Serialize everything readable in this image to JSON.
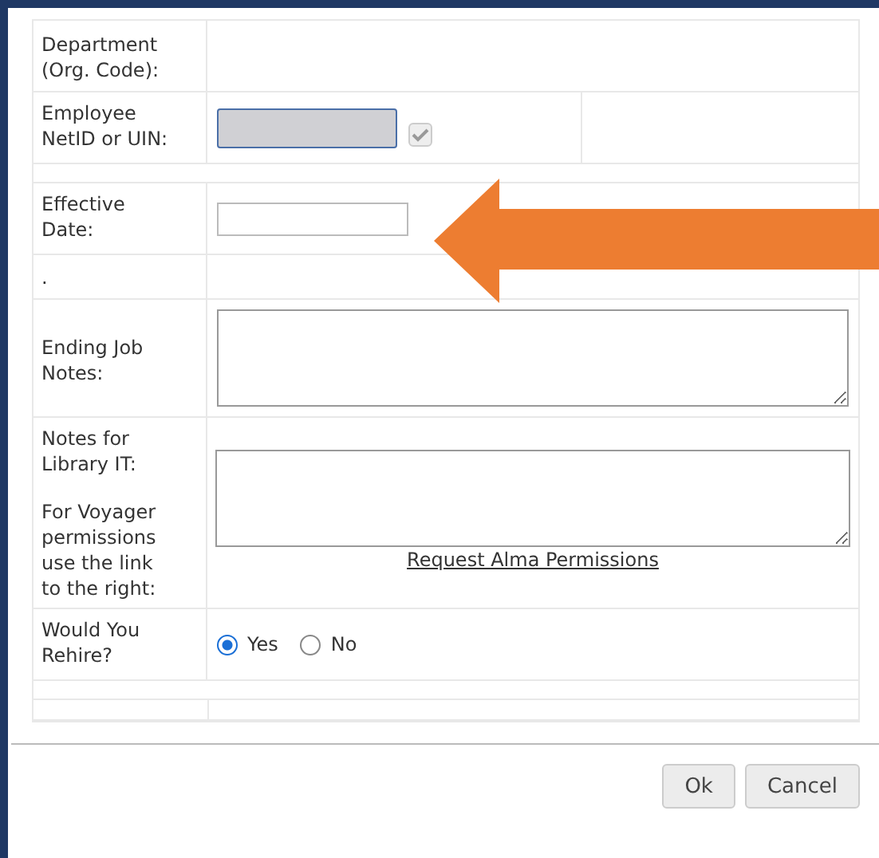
{
  "form": {
    "rows": [
      {
        "kind": "text",
        "label": "Department (Org. Code):"
      },
      {
        "kind": "netid",
        "label": "Employee NetID or UIN:",
        "checked": true
      },
      {
        "kind": "spacer"
      },
      {
        "kind": "input",
        "label": "Effective Date:"
      },
      {
        "kind": "text",
        "label": "."
      },
      {
        "kind": "textarea",
        "label": "Ending Job Notes:"
      },
      {
        "kind": "textarea",
        "label": "Notes for Library IT:",
        "note": "For Voyager permissions use the link to the right:",
        "link": "Request Alma Permissions"
      },
      {
        "kind": "radio",
        "label": "Would You Rehire?",
        "options": [
          {
            "label": "Yes",
            "selected": true
          },
          {
            "label": "No",
            "selected": false
          }
        ]
      },
      {
        "kind": "spacer"
      },
      {
        "kind": "blank"
      }
    ]
  },
  "buttons": [
    "Ok",
    "Cancel"
  ]
}
